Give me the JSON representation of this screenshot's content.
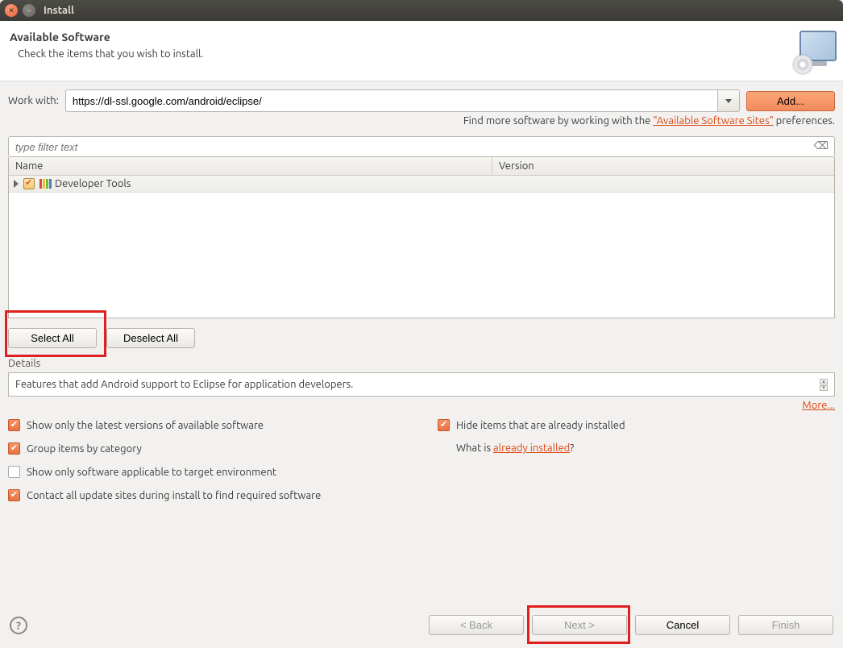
{
  "window": {
    "title": "Install"
  },
  "header": {
    "title": "Available Software",
    "subtitle": "Check the items that you wish to install."
  },
  "workwith": {
    "label": "Work with:",
    "value": "https://dl-ssl.google.com/android/eclipse/",
    "add_label": "Add..."
  },
  "hint": {
    "prefix": "Find more software by working with the ",
    "link": "\"Available Software Sites\"",
    "suffix": " preferences."
  },
  "filter": {
    "placeholder": "type filter text"
  },
  "tree": {
    "col_name": "Name",
    "col_version": "Version",
    "items": [
      {
        "label": "Developer Tools",
        "checked": true
      }
    ]
  },
  "selection": {
    "select_all": "Select All",
    "deselect_all": "Deselect All"
  },
  "details": {
    "label": "Details",
    "text": "Features that add Android support to Eclipse for application developers.",
    "more": "More..."
  },
  "options": {
    "latest": "Show only the latest versions of available software",
    "group": "Group items by category",
    "target_env": "Show only software applicable to target environment",
    "contact_sites": "Contact all update sites during install to find required software",
    "hide_installed": "Hide items that are already installed",
    "whatis_prefix": "What is ",
    "whatis_link": "already installed",
    "whatis_suffix": "?"
  },
  "buttons": {
    "back": "< Back",
    "next": "Next >",
    "cancel": "Cancel",
    "finish": "Finish"
  }
}
